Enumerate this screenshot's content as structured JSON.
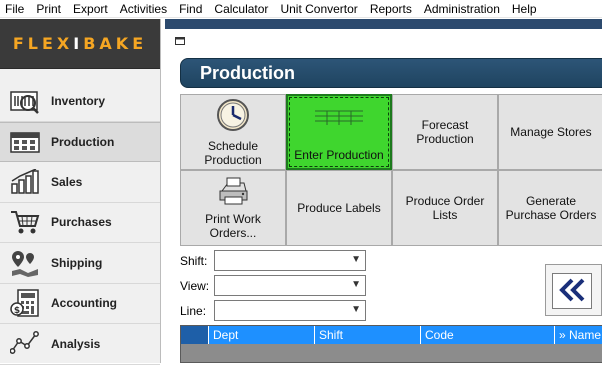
{
  "menu": [
    "File",
    "Print",
    "Export",
    "Activities",
    "Find",
    "Calculator",
    "Unit Convertor",
    "Reports",
    "Administration",
    "Help"
  ],
  "logo": {
    "left": "FLEX",
    "x": "I",
    "right": "BAKE"
  },
  "sidebar": {
    "items": [
      {
        "label": "Inventory",
        "icon": "inventory-icon"
      },
      {
        "label": "Production",
        "icon": "production-icon"
      },
      {
        "label": "Sales",
        "icon": "sales-icon"
      },
      {
        "label": "Purchases",
        "icon": "cart-icon"
      },
      {
        "label": "Shipping",
        "icon": "shipping-icon"
      },
      {
        "label": "Accounting",
        "icon": "accounting-icon"
      },
      {
        "label": "Analysis",
        "icon": "analysis-icon"
      }
    ],
    "active_index": 1
  },
  "page_title": "Production",
  "tiles": {
    "schedule": "Schedule Production",
    "enter": "Enter Production",
    "forecast": "Forecast Production",
    "manage_stores": "Manage Stores",
    "print_work_orders": "Print Work Orders...",
    "produce_labels": "Produce Labels",
    "produce_order_lists": "Produce Order Lists",
    "generate_po": "Generate Purchase Orders"
  },
  "filters": {
    "shift_label": "Shift:",
    "view_label": "View:",
    "line_label": "Line:"
  },
  "grid": {
    "columns": [
      "Dept",
      "Shift",
      "Code",
      "» Name"
    ]
  },
  "colors": {
    "active_tile": "#3fd62e",
    "title_bar": "#2d5577",
    "grid_header": "#1e90ff"
  }
}
